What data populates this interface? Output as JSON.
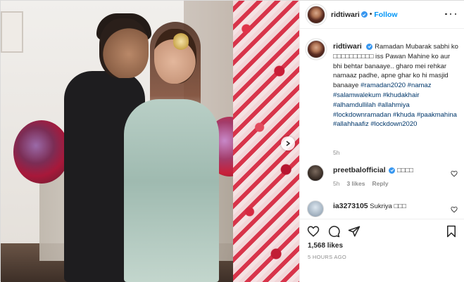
{
  "post": {
    "author": "ridtiwari",
    "follow_label": "Follow",
    "separator": "•"
  },
  "caption": {
    "username": "ridtiwari",
    "text": "Ramadan Mubarak sabhi ko □□□□□□□□□□ iss Pawan Mahine ko aur bhi behtar banaaye.. gharo mei rehkar namaaz padhe, apne ghar ko hi masjid banaaye",
    "hashtags": [
      "#ramadan2020",
      "#namaz",
      "#salamwalekum",
      "#khudakhair",
      "#alhamdullilah",
      "#allahmiya",
      "#lockdownramadan",
      "#khuda",
      "#paakmahina",
      "#allahhaafiz",
      "#lockdown2020"
    ],
    "time": "5h"
  },
  "comments": [
    {
      "username": "preetbalofficial",
      "verified": true,
      "text": "□□□□",
      "time": "5h",
      "likes": "3 likes",
      "reply": "Reply"
    },
    {
      "username": "ia3273105",
      "verified": false,
      "text": "Sukriya □□□",
      "time": "",
      "likes": "",
      "reply": ""
    }
  ],
  "footer": {
    "likes": "1,568 likes",
    "timestamp": "5 HOURS AGO"
  },
  "colors": {
    "link": "#00376b",
    "follow": "#0095f6",
    "verified": "#3897f0",
    "meta": "#8e8e8e"
  },
  "icons": [
    "chevron-right-icon",
    "more-icon",
    "verified-icon",
    "heart-icon",
    "comment-icon",
    "share-icon",
    "bookmark-icon"
  ]
}
